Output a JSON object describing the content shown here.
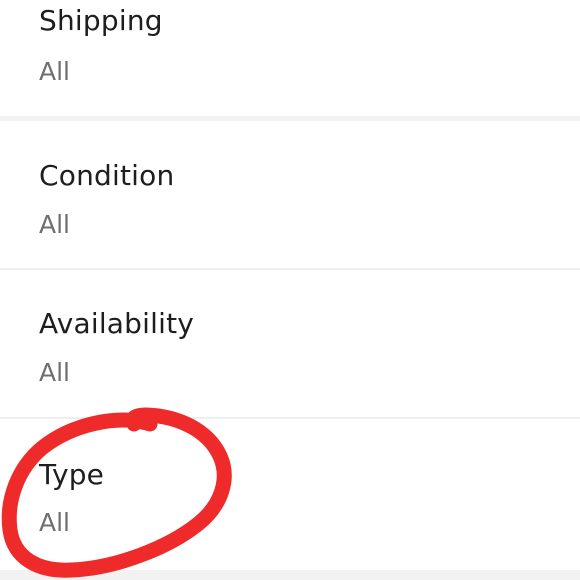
{
  "filters": [
    {
      "id": "shipping",
      "title": "Shipping",
      "value": "All"
    },
    {
      "id": "condition",
      "title": "Condition",
      "value": "All"
    },
    {
      "id": "availability",
      "title": "Availability",
      "value": "All"
    },
    {
      "id": "type",
      "title": "Type",
      "value": "All"
    }
  ],
  "annotation": {
    "shape": "hand-drawn circle",
    "color": "#ee2a2a",
    "target": "type"
  }
}
